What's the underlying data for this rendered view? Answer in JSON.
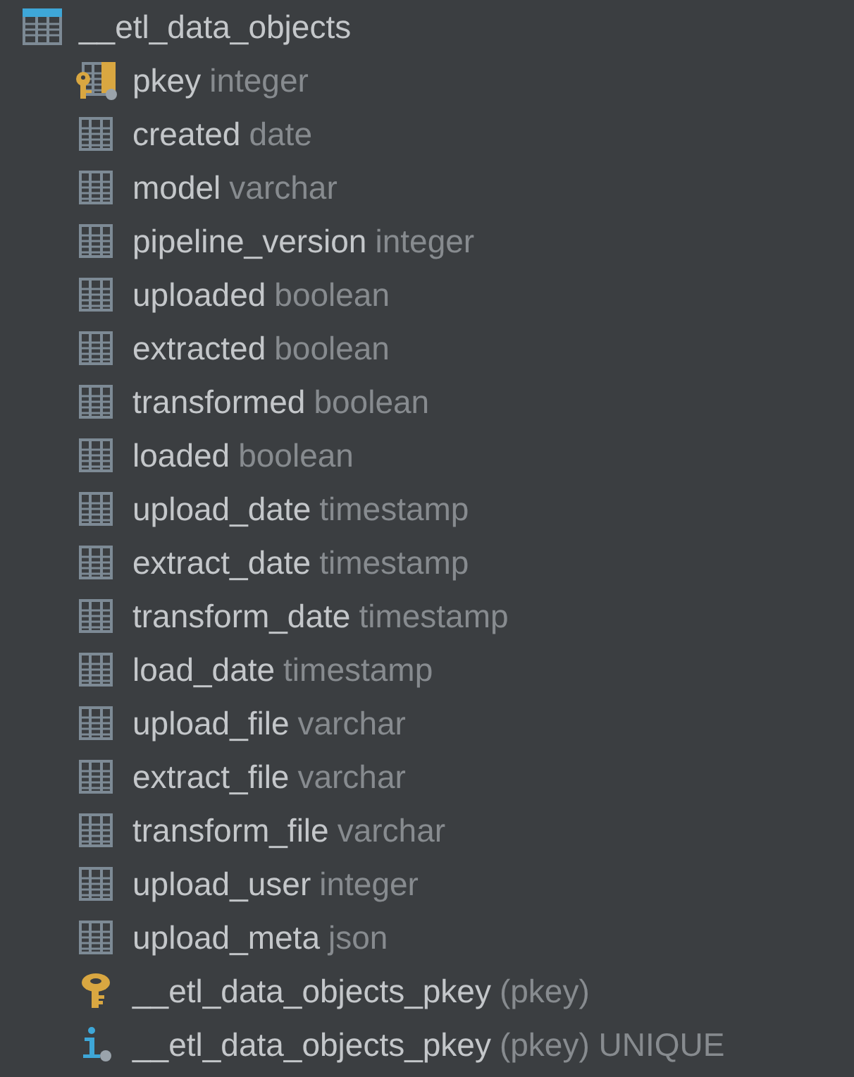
{
  "table": {
    "name": "__etl_data_objects",
    "children": [
      {
        "kind": "pk_column",
        "name": "pkey",
        "detail": "integer"
      },
      {
        "kind": "column",
        "name": "created",
        "detail": "date"
      },
      {
        "kind": "column",
        "name": "model",
        "detail": "varchar"
      },
      {
        "kind": "column",
        "name": "pipeline_version",
        "detail": "integer"
      },
      {
        "kind": "column",
        "name": "uploaded",
        "detail": "boolean"
      },
      {
        "kind": "column",
        "name": "extracted",
        "detail": "boolean"
      },
      {
        "kind": "column",
        "name": "transformed",
        "detail": "boolean"
      },
      {
        "kind": "column",
        "name": "loaded",
        "detail": "boolean"
      },
      {
        "kind": "column",
        "name": "upload_date",
        "detail": "timestamp"
      },
      {
        "kind": "column",
        "name": "extract_date",
        "detail": "timestamp"
      },
      {
        "kind": "column",
        "name": "transform_date",
        "detail": "timestamp"
      },
      {
        "kind": "column",
        "name": "load_date",
        "detail": "timestamp"
      },
      {
        "kind": "column",
        "name": "upload_file",
        "detail": "varchar"
      },
      {
        "kind": "column",
        "name": "extract_file",
        "detail": "varchar"
      },
      {
        "kind": "column",
        "name": "transform_file",
        "detail": "varchar"
      },
      {
        "kind": "column",
        "name": "upload_user",
        "detail": "integer"
      },
      {
        "kind": "column",
        "name": "upload_meta",
        "detail": "json"
      },
      {
        "kind": "key",
        "name": "__etl_data_objects_pkey",
        "detail": "(pkey)"
      },
      {
        "kind": "index",
        "name": "__etl_data_objects_pkey",
        "detail": "(pkey) UNIQUE"
      }
    ]
  }
}
